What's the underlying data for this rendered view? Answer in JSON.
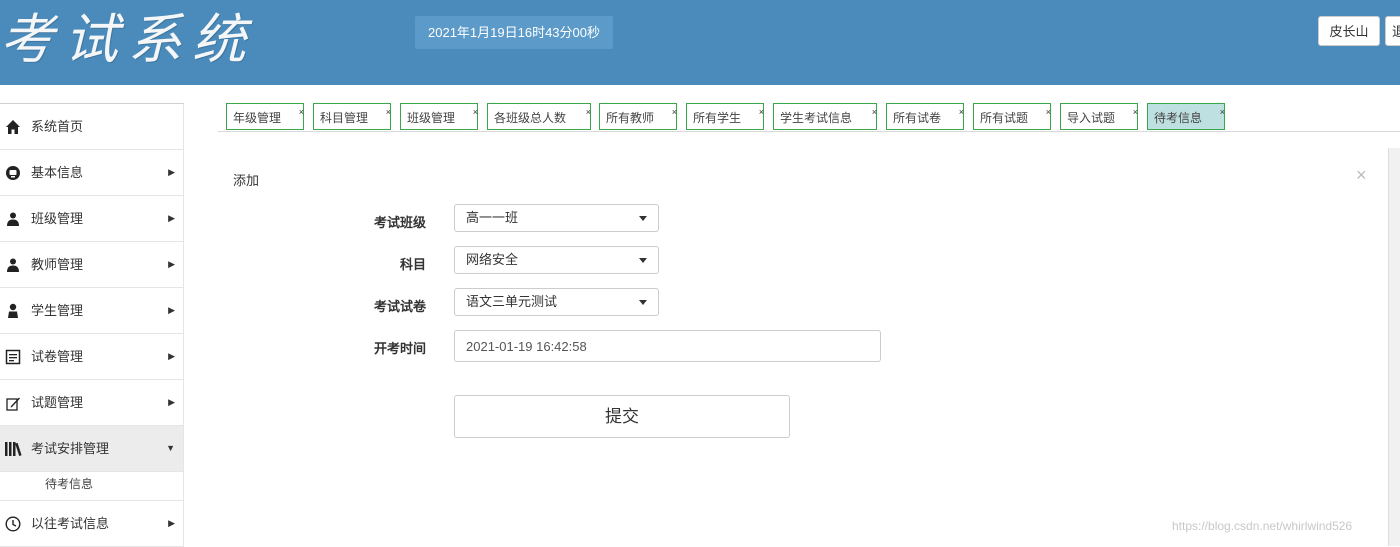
{
  "header": {
    "logo_text": "考试系统",
    "clock": "2021年1月19日16时43分00秒",
    "user_label": "皮长山",
    "logout_label": "退"
  },
  "sidebar": {
    "items": [
      {
        "label": "系统首页",
        "icon": "home-icon"
      },
      {
        "label": "基本信息",
        "icon": "info-icon"
      },
      {
        "label": "班级管理",
        "icon": "users-icon"
      },
      {
        "label": "教师管理",
        "icon": "users-icon"
      },
      {
        "label": "学生管理",
        "icon": "user-icon"
      },
      {
        "label": "试卷管理",
        "icon": "document-icon"
      },
      {
        "label": "试题管理",
        "icon": "edit-icon"
      },
      {
        "label": "考试安排管理",
        "icon": "books-icon"
      },
      {
        "label": "以往考试信息",
        "icon": "clock-icon"
      }
    ],
    "sub_items": [
      {
        "label": "待考信息"
      }
    ]
  },
  "tabs": [
    {
      "label": "年级管理"
    },
    {
      "label": "科目管理"
    },
    {
      "label": "班级管理"
    },
    {
      "label": "各班级总人数"
    },
    {
      "label": "所有教师"
    },
    {
      "label": "所有学生"
    },
    {
      "label": "学生考试信息"
    },
    {
      "label": "所有试卷"
    },
    {
      "label": "所有试题"
    },
    {
      "label": "导入试题"
    },
    {
      "label": "待考信息"
    }
  ],
  "tab_close": "×",
  "form": {
    "title": "添加",
    "close": "×",
    "class_label": "考试班级",
    "class_value": "高一一班",
    "subject_label": "科目",
    "subject_value": "网络安全",
    "paper_label": "考试试卷",
    "paper_value": "语文三单元测试",
    "time_label": "开考时间",
    "time_value": "2021-01-19 16:42:58",
    "submit_label": "提交"
  },
  "watermark": "https://blog.csdn.net/whirlwind526",
  "colors": {
    "header_bg": "#4a8bbb",
    "tab_border": "#3aa84a",
    "tab_active_bg": "#bfe0e0"
  }
}
